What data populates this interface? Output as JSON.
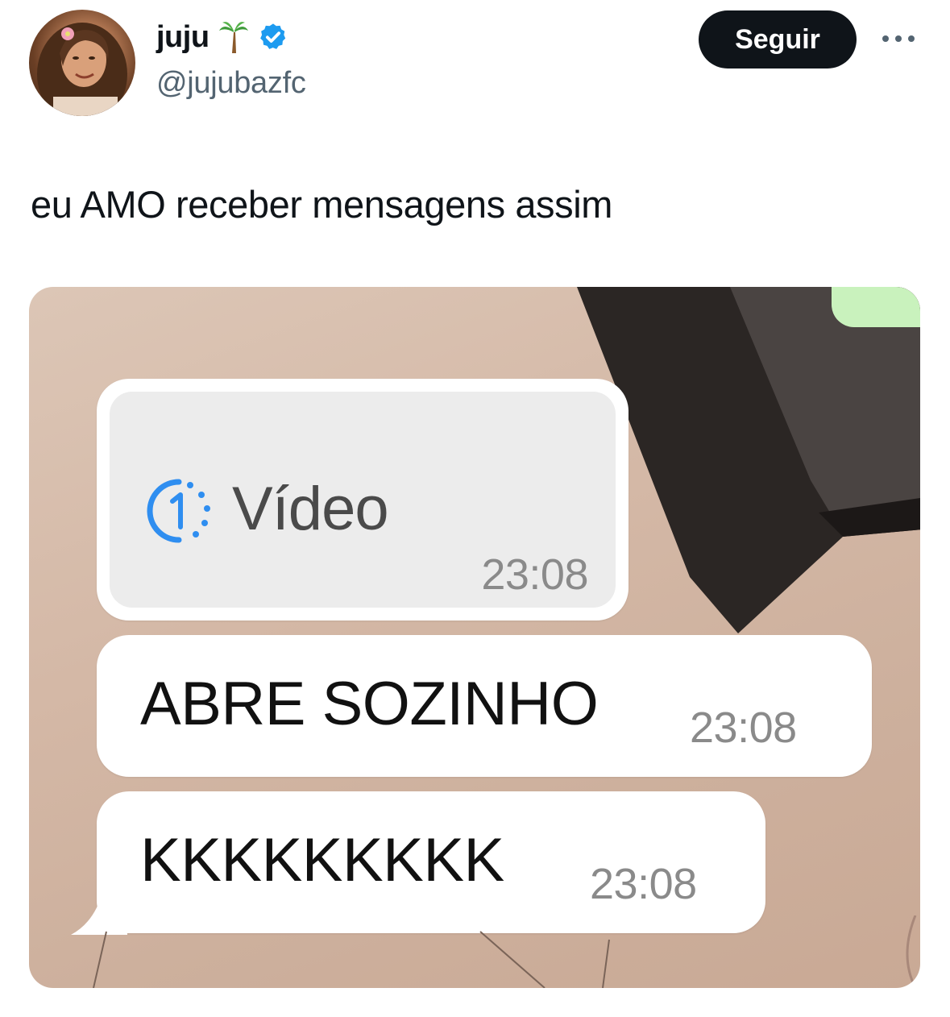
{
  "header": {
    "display_name": "juju",
    "handle": "@jujubazfc",
    "follow_label": "Seguir",
    "icons": [
      "palm-tree-icon",
      "verified-badge-icon",
      "more-options-icon"
    ],
    "verified_color": "#1d9bf0"
  },
  "tweet": {
    "text": "eu AMO receber mensagens assim"
  },
  "media": {
    "messages": [
      {
        "type": "video",
        "label": "Vídeo",
        "time": "23:08",
        "icon": "view-once-icon"
      },
      {
        "type": "text",
        "text": "ABRE SOZINHO",
        "time": "23:08"
      },
      {
        "type": "text",
        "text": "KKKKKKKKK",
        "time": "23:08"
      }
    ]
  },
  "colors": {
    "follow_bg": "#0f1419",
    "handle": "#536471",
    "view_once_accent": "#2f8ef0"
  }
}
